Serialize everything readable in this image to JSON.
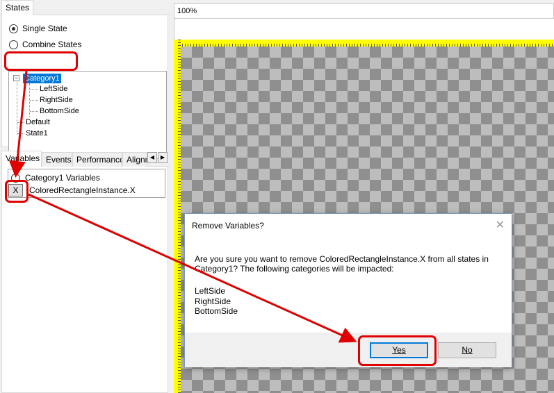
{
  "states_panel": {
    "tab_label": "States",
    "radio_single": "Single State",
    "radio_combine": "Combine States",
    "tree": {
      "category": "Category1",
      "children": [
        "LeftSide",
        "RightSide",
        "BottomSide"
      ],
      "default": "Default",
      "state1": "State1"
    }
  },
  "bottom_tabs": [
    "Variables",
    "Events",
    "Performance",
    "Alignm"
  ],
  "variables_panel": {
    "group_label": "Category1 Variables",
    "variable_label": "ColoredRectangleInstance.X",
    "remove_button_label": "X"
  },
  "canvas": {
    "zoom_label": "100%"
  },
  "dialog": {
    "title": "Remove Variables?",
    "close_glyph": "✕",
    "message": "Are you sure you want to remove ColoredRectangleInstance.X from all states in\nCategory1? The following categories will be impacted:",
    "impacted": [
      "LeftSide",
      "RightSide",
      "BottomSide"
    ],
    "yes_label": "Yes",
    "no_label": "No"
  },
  "colors": {
    "annotation_red": "#e00000",
    "selection_blue": "#0078d7",
    "ruler_yellow": "#ffff00"
  }
}
